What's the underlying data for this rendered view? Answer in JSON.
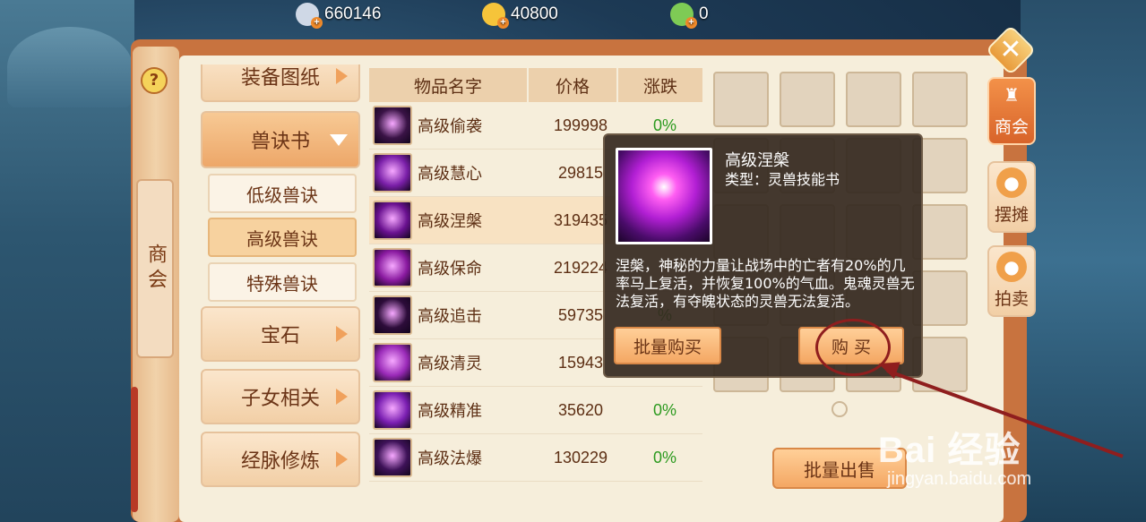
{
  "currencies": [
    {
      "icon": "silver-coin-icon",
      "value": "660146",
      "color": "#cfd8e6"
    },
    {
      "icon": "gold-coin-icon",
      "value": "40800",
      "color": "#f6c43a"
    },
    {
      "icon": "jade-coin-icon",
      "value": "0",
      "color": "#7ecb55"
    }
  ],
  "sidebar": {
    "help": "?",
    "tag": "商会"
  },
  "categories": {
    "top_partial": "装备图纸",
    "open": "兽诀书",
    "subs": [
      "低级兽诀",
      "高级兽诀",
      "特殊兽诀"
    ],
    "selected_sub": "高级兽诀",
    "rest": [
      "宝石",
      "子女相关",
      "经脉修炼"
    ]
  },
  "table": {
    "headers": [
      "物品名字",
      "价格",
      "涨跌"
    ],
    "rows": [
      {
        "name": "高级偷袭",
        "price": "199998",
        "change": "0%",
        "color": "#3a1346"
      },
      {
        "name": "高级慧心",
        "price": "29815",
        "change": "",
        "color": "#7a1fa8"
      },
      {
        "name": "高级涅槃",
        "price": "319435",
        "change": "",
        "color": "#6a1190"
      },
      {
        "name": "高级保命",
        "price": "219224",
        "change": "",
        "color": "#8a1aa0"
      },
      {
        "name": "高级追击",
        "price": "59735",
        "change": "%",
        "color": "#2d0c3a"
      },
      {
        "name": "高级清灵",
        "price": "15943",
        "change": "",
        "color": "#9a2ab8"
      },
      {
        "name": "高级精准",
        "price": "35620",
        "change": "0%",
        "color": "#7b1fb2"
      },
      {
        "name": "高级法爆",
        "price": "130229",
        "change": "0%",
        "color": "#3e1258"
      }
    ]
  },
  "tooltip": {
    "title": "高级涅槃",
    "type": "类型：灵兽技能书",
    "description": "涅槃，神秘的力量让战场中的亡者有20%的几率马上复活，并恢复100%的气血。鬼魂灵兽无法复活，有夺魄状态的灵兽无法复活。",
    "bulk_buy": "批量购买",
    "buy": "购 买"
  },
  "inventory": {
    "bulk_sell": "批量出售"
  },
  "right_tabs": [
    {
      "label": "商会",
      "icon": "guild-icon",
      "active": true
    },
    {
      "label": "摆摊",
      "icon": "stall-icon",
      "active": false
    },
    {
      "label": "拍卖",
      "icon": "auction-icon",
      "active": false
    }
  ],
  "close_icon": "close-icon",
  "watermark": {
    "brand": "Bai 经验",
    "url": "jingyan.baidu.com"
  },
  "colors": {
    "accent": "#d8642a",
    "panel": "#f6eedb",
    "positive": "#2c9a1f",
    "annotation": "#8f1e1e"
  }
}
